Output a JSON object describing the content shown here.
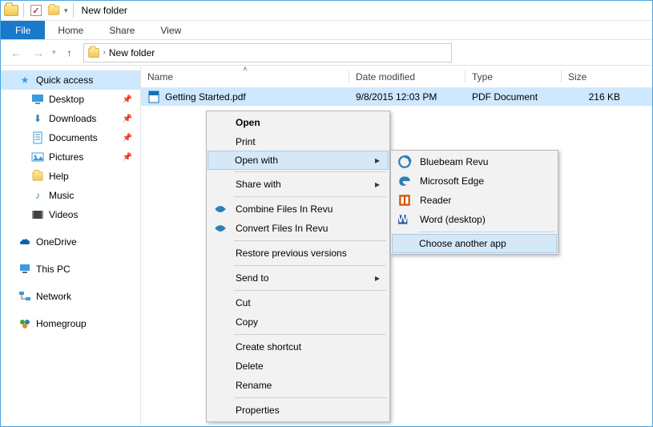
{
  "window": {
    "title": "New folder"
  },
  "tabs": {
    "file": "File",
    "home": "Home",
    "share": "Share",
    "view": "View"
  },
  "breadcrumb": {
    "current": "New folder"
  },
  "columns": {
    "name": "Name",
    "date": "Date modified",
    "type": "Type",
    "size": "Size"
  },
  "file": {
    "name": "Getting Started.pdf",
    "date": "9/8/2015 12:03 PM",
    "type": "PDF Document",
    "size": "216 KB"
  },
  "sidebar": {
    "quick": "Quick access",
    "items": [
      {
        "label": "Desktop",
        "pin": true
      },
      {
        "label": "Downloads",
        "pin": true
      },
      {
        "label": "Documents",
        "pin": true
      },
      {
        "label": "Pictures",
        "pin": true
      },
      {
        "label": "Help",
        "pin": false
      },
      {
        "label": "Music",
        "pin": false
      },
      {
        "label": "Videos",
        "pin": false
      }
    ],
    "onedrive": "OneDrive",
    "thispc": "This PC",
    "network": "Network",
    "homegroup": "Homegroup"
  },
  "ctx": {
    "open": "Open",
    "print": "Print",
    "openwith": "Open with",
    "sharewith": "Share with",
    "combine": "Combine Files In Revu",
    "convert": "Convert Files In Revu",
    "restore": "Restore previous versions",
    "sendto": "Send to",
    "cut": "Cut",
    "copy": "Copy",
    "shortcut": "Create shortcut",
    "delete": "Delete",
    "rename": "Rename",
    "properties": "Properties"
  },
  "openwith": {
    "apps": [
      {
        "label": "Bluebeam Revu"
      },
      {
        "label": "Microsoft Edge"
      },
      {
        "label": "Reader"
      },
      {
        "label": "Word (desktop)"
      }
    ],
    "choose": "Choose another app"
  }
}
